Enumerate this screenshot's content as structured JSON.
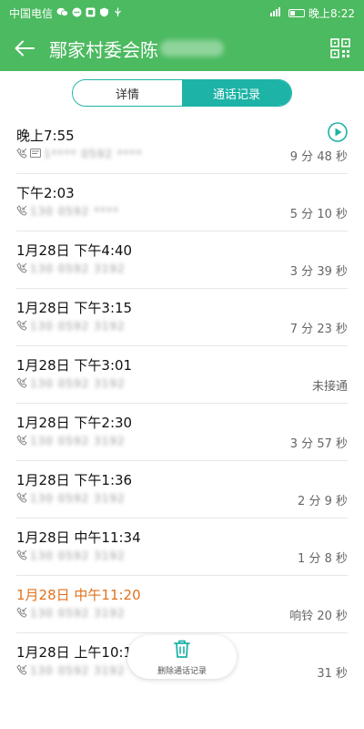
{
  "status_bar": {
    "carrier": "中国电信",
    "time": "晚上8:22",
    "battery_level": 0.35,
    "icons": [
      "wechat-icon",
      "chat-bubble-icon",
      "app-icon",
      "shield-icon",
      "usb-icon",
      "signal-icon",
      "battery-icon"
    ]
  },
  "app_bar": {
    "title": "鄢家村委会陈",
    "back_icon": "arrow-left-icon",
    "qr_icon": "qr-code-icon"
  },
  "tabs": [
    {
      "label": "详情",
      "active": false
    },
    {
      "label": "通话记录",
      "active": true
    }
  ],
  "calls": [
    {
      "time": "晚上7:55",
      "number": "1**** 0592 ****",
      "duration": "9 分 48 秒",
      "sms_icon": true,
      "play": true,
      "missed": false
    },
    {
      "time": "下午2:03",
      "number": "130 0592 ****",
      "duration": "5 分 10 秒",
      "sms_icon": false,
      "play": false,
      "missed": false
    },
    {
      "time": "1月28日 下午4:40",
      "number": "130 0592 3192",
      "duration": "3 分 39 秒",
      "sms_icon": false,
      "play": false,
      "missed": false
    },
    {
      "time": "1月28日 下午3:15",
      "number": "130 0592 3192",
      "duration": "7 分 23 秒",
      "sms_icon": false,
      "play": false,
      "missed": false
    },
    {
      "time": "1月28日 下午3:01",
      "number": "130 0592 3192",
      "duration": "未接通",
      "sms_icon": false,
      "play": false,
      "missed": false
    },
    {
      "time": "1月28日 下午2:30",
      "number": "130 0592 3192",
      "duration": "3 分 57 秒",
      "sms_icon": false,
      "play": false,
      "missed": false
    },
    {
      "time": "1月28日 下午1:36",
      "number": "130 0592 3192",
      "duration": "2 分 9 秒",
      "sms_icon": false,
      "play": false,
      "missed": false
    },
    {
      "time": "1月28日 中午11:34",
      "number": "130 0592 3192",
      "duration": "1 分 8 秒",
      "sms_icon": false,
      "play": false,
      "missed": false
    },
    {
      "time": "1月28日 中午11:20",
      "number": "130 0592 3192",
      "duration": "响铃 20 秒",
      "sms_icon": false,
      "play": false,
      "missed": true
    },
    {
      "time": "1月28日 上午10:1",
      "number": "130 0592 3192",
      "duration": "31 秒",
      "sms_icon": false,
      "play": false,
      "missed": false
    }
  ],
  "fab": {
    "label": "删除通话记录",
    "icon": "trash-icon"
  },
  "colors": {
    "app_green": "#4cba60",
    "accent_teal": "#1db3a6",
    "missed_orange": "#e2711d"
  }
}
